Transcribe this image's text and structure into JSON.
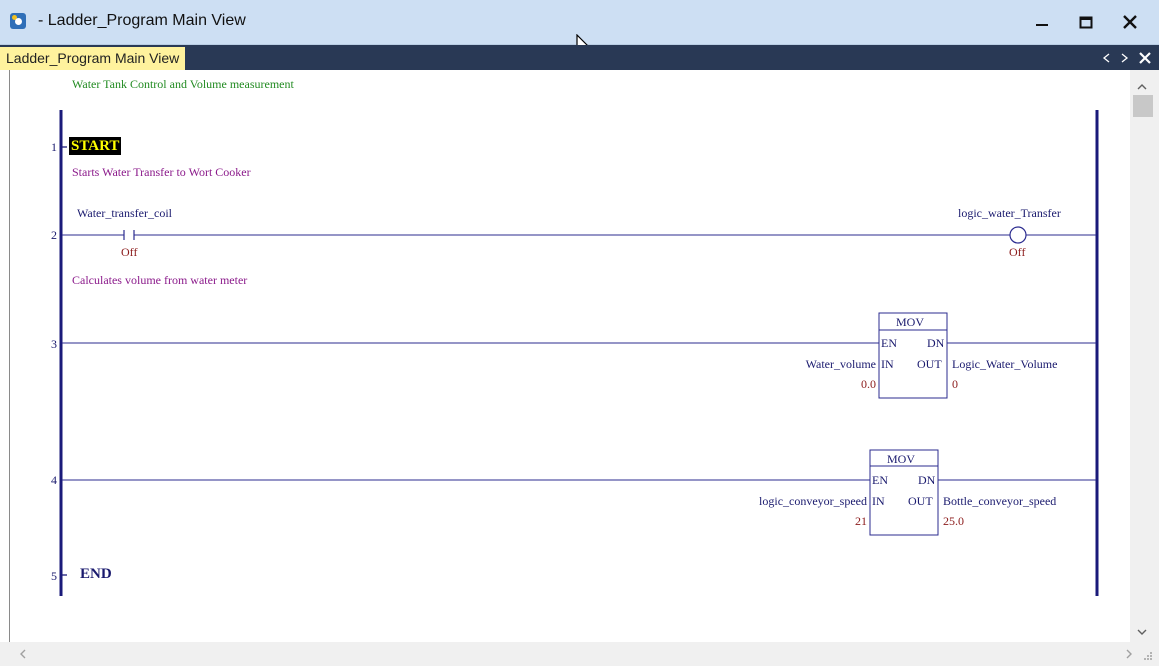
{
  "window": {
    "title": "- Ladder_Program Main View",
    "minimize_icon": "minimize-icon",
    "maximize_icon": "maximize-icon",
    "close_icon": "close-icon"
  },
  "tabs": {
    "active_label": "Ladder_Program Main View"
  },
  "ladder": {
    "description": "Water Tank Control and Volume measurement",
    "rungs": [
      {
        "number": "1",
        "label": "START",
        "comment": "Starts Water Transfer to Wort Cooker"
      },
      {
        "number": "2",
        "contact_tag": "Water_transfer_coil",
        "contact_state": "Off",
        "coil_tag": "logic_water_Transfer",
        "coil_state": "Off",
        "comment": "Calculates volume from water meter"
      },
      {
        "number": "3",
        "block": "MOV",
        "en": "EN",
        "dn": "DN",
        "in_label": "IN",
        "out_label": "OUT",
        "in_tag": "Water_volume",
        "in_value": "0.0",
        "out_tag": "Logic_Water_Volume",
        "out_value": "0"
      },
      {
        "number": "4",
        "block": "MOV",
        "en": "EN",
        "dn": "DN",
        "in_label": "IN",
        "out_label": "OUT",
        "in_tag": "logic_conveyor_speed",
        "in_value": "21",
        "out_tag": "Bottle_conveyor_speed",
        "out_value": "25.0"
      },
      {
        "number": "5",
        "label": "END"
      }
    ]
  },
  "colors": {
    "rail": "#1a1a7a",
    "wire": "#2b2b8f",
    "tag": "#1a1a6e",
    "value": "#8b1a1a",
    "comment": "#8b1a8b",
    "description": "#228b22",
    "start_highlight": "#000000",
    "start_text": "#ffff00"
  }
}
